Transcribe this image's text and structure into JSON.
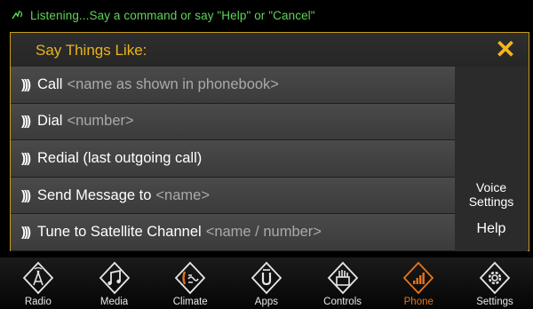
{
  "status": {
    "icon": "voice-listening-icon",
    "text": "Listening...Say a command or say \"Help\" or \"Cancel\"",
    "color": "#5fd35a"
  },
  "panel": {
    "title": "Say Things Like:",
    "close_icon": "close-icon",
    "accent_color": "#e9b21f",
    "commands": [
      {
        "label": "Call",
        "hint": "<name as shown in phonebook>"
      },
      {
        "label": "Dial",
        "hint": "<number>"
      },
      {
        "label": "Redial (last outgoing call)",
        "hint": ""
      },
      {
        "label": "Send Message to",
        "hint": "<name>"
      },
      {
        "label": "Tune to Satellite Channel",
        "hint": "<name / number>"
      }
    ],
    "voice_settings_line1": "Voice",
    "voice_settings_line2": "Settings",
    "help_label": "Help"
  },
  "nav": {
    "active_color": "#e8731b",
    "items": [
      {
        "label": "Radio",
        "icon": "radio-icon"
      },
      {
        "label": "Media",
        "icon": "music-note-icon"
      },
      {
        "label": "Climate",
        "icon": "climate-icon"
      },
      {
        "label": "Apps",
        "icon": "apps-icon"
      },
      {
        "label": "Controls",
        "icon": "controls-icon"
      },
      {
        "label": "Phone",
        "icon": "phone-signal-icon",
        "active": true
      },
      {
        "label": "Settings",
        "icon": "gear-icon"
      }
    ]
  }
}
